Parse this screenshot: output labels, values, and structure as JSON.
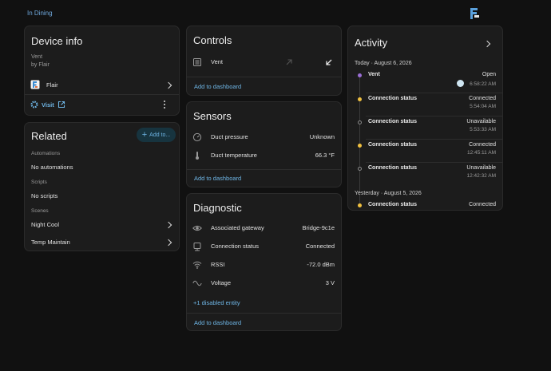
{
  "breadcrumb": "In Dining",
  "device_info": {
    "title": "Device info",
    "model": "Vent",
    "manufacturer": "by Flair",
    "integration": "Flair",
    "visit_label": "Visit"
  },
  "related": {
    "title": "Related",
    "add_button": "Add to...",
    "automations_header": "Automations",
    "automations_value": "No automations",
    "scripts_header": "Scripts",
    "scripts_value": "No scripts",
    "scenes_header": "Scenes",
    "scenes": [
      "Night Cool",
      "Temp Maintain"
    ]
  },
  "controls": {
    "title": "Controls",
    "entity": "Vent",
    "add_to_dashboard": "Add to dashboard"
  },
  "sensors": {
    "title": "Sensors",
    "items": [
      {
        "name": "Duct pressure",
        "value": "Unknown",
        "icon": "gauge-icon"
      },
      {
        "name": "Duct temperature",
        "value": "66.3 °F",
        "icon": "thermometer-icon"
      }
    ],
    "add_to_dashboard": "Add to dashboard"
  },
  "diagnostic": {
    "title": "Diagnostic",
    "items": [
      {
        "name": "Associated gateway",
        "value": "Bridge-9c1e",
        "icon": "eye-icon"
      },
      {
        "name": "Connection status",
        "value": "Connected",
        "icon": "plug-icon"
      },
      {
        "name": "RSSI",
        "value": "-72.0 dBm",
        "icon": "wifi-icon"
      },
      {
        "name": "Voltage",
        "value": "3 V",
        "icon": "sine-wave-icon"
      }
    ],
    "disabled_link": "+1 disabled entity",
    "add_to_dashboard": "Add to dashboard"
  },
  "activity": {
    "title": "Activity",
    "today_header": "Today · August 6, 2026",
    "events": [
      {
        "name": "Vent",
        "state": "Open",
        "time": "6:58:22 AM",
        "dot": "#9b6fd6"
      },
      {
        "name": "Connection status",
        "state": "Connected",
        "time": "5:54:04 AM",
        "dot": "#f0c040"
      },
      {
        "name": "Connection status",
        "state": "Unavailable",
        "time": "5:53:33 AM",
        "dot": "hollow"
      },
      {
        "name": "Connection status",
        "state": "Connected",
        "time": "12:45:11 AM",
        "dot": "#f0c040"
      },
      {
        "name": "Connection status",
        "state": "Unavailable",
        "time": "12:42:32 AM",
        "dot": "hollow"
      }
    ],
    "yesterday_header": "Yesterday · August 5, 2026",
    "yesterday_event": {
      "name": "Connection status",
      "state": "Connected"
    }
  },
  "colors": {
    "accent": "#6fb6e6",
    "card": "#1c1c1c",
    "background": "#111111"
  }
}
